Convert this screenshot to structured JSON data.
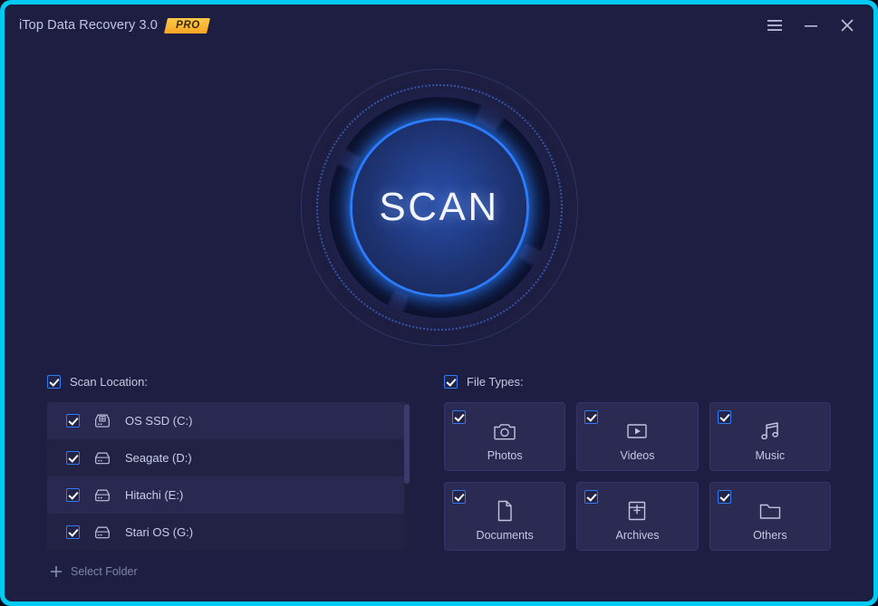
{
  "window": {
    "title": "iTop Data Recovery 3.0",
    "pro_badge": "PRO",
    "border_color": "#00c9f2",
    "background_color": "#1e1e42",
    "controls": [
      {
        "name": "menu-button",
        "icon": "hamburger-icon"
      },
      {
        "name": "minimize-button",
        "icon": "minimize-icon"
      },
      {
        "name": "close-button",
        "icon": "close-icon"
      }
    ]
  },
  "scan": {
    "button_label": "SCAN",
    "accent_color": "#2b7dff"
  },
  "scan_location": {
    "header_label": "Scan Location:",
    "header_checked": true,
    "drives": [
      {
        "label": "OS SSD (C:)",
        "icon": "system-drive-icon",
        "checked": true
      },
      {
        "label": "Seagate (D:)",
        "icon": "drive-icon",
        "checked": true
      },
      {
        "label": "Hitachi (E:)",
        "icon": "drive-icon",
        "checked": true
      },
      {
        "label": "Stari OS (G:)",
        "icon": "drive-icon",
        "checked": true
      }
    ],
    "select_folder_label": "Select Folder",
    "select_folder_icon": "plus-icon"
  },
  "file_types": {
    "header_label": "File Types:",
    "header_checked": true,
    "tiles": [
      {
        "label": "Photos",
        "icon": "camera-icon",
        "checked": true
      },
      {
        "label": "Videos",
        "icon": "video-icon",
        "checked": true
      },
      {
        "label": "Music",
        "icon": "music-icon",
        "checked": true
      },
      {
        "label": "Documents",
        "icon": "document-icon",
        "checked": true
      },
      {
        "label": "Archives",
        "icon": "archive-icon",
        "checked": true
      },
      {
        "label": "Others",
        "icon": "folder-icon",
        "checked": true
      }
    ]
  }
}
